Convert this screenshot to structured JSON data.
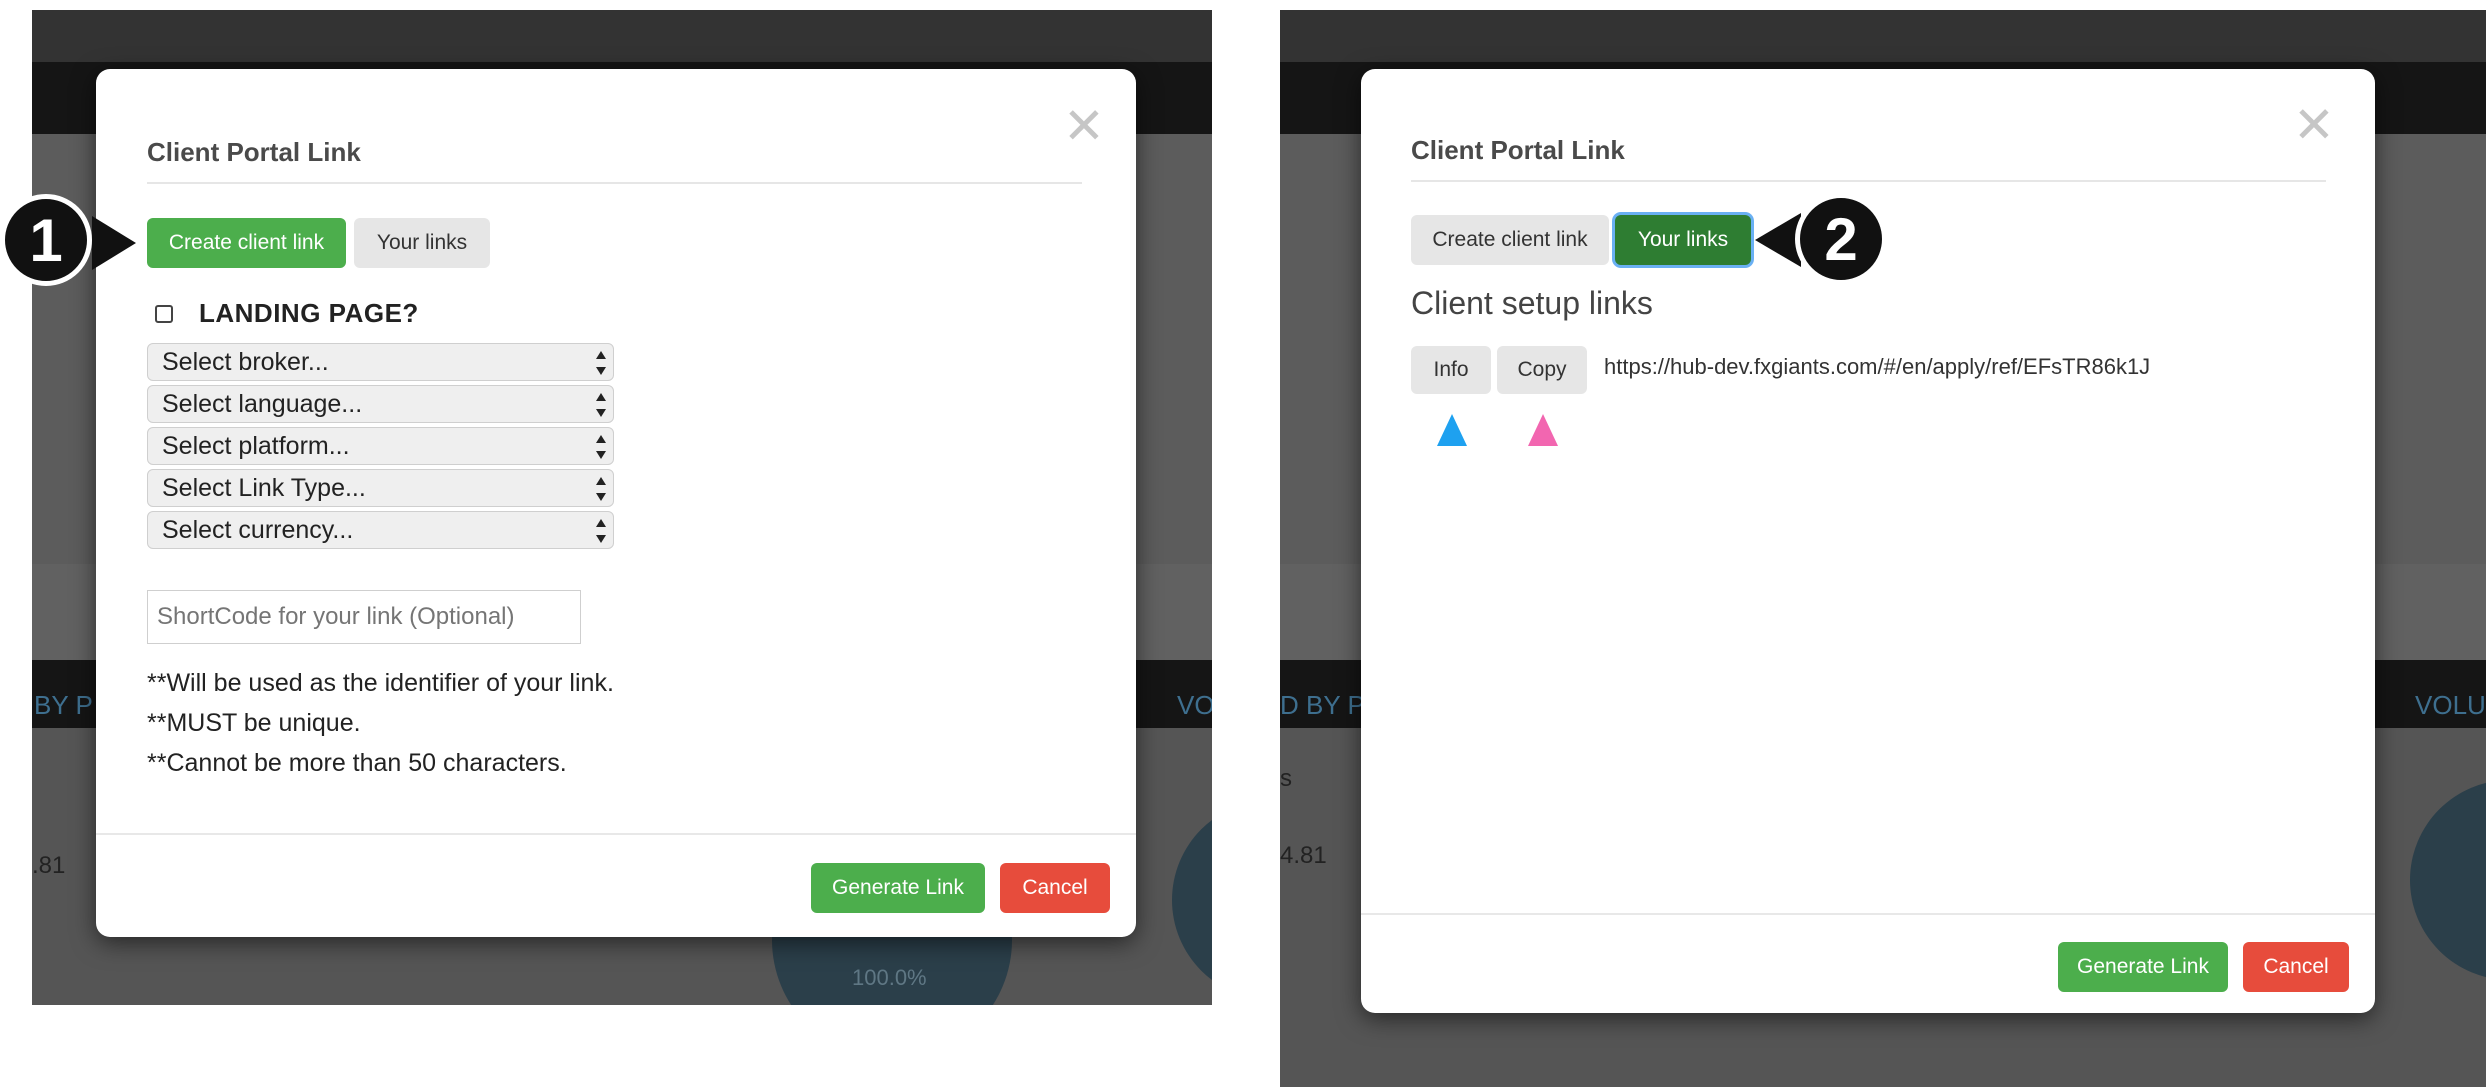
{
  "left_panel": {
    "modal": {
      "title": "Client Portal Link",
      "close_icon": "✕",
      "tabs": {
        "create": "Create client link",
        "your_links": "Your links",
        "active": "create"
      },
      "landing_page_label": "LANDING PAGE?",
      "landing_page_checked": false,
      "selects": [
        "Select broker...",
        "Select language...",
        "Select platform...",
        "Select Link Type...",
        "Select currency..."
      ],
      "shortcode_placeholder": "ShortCode for your link (Optional)",
      "notes": [
        "**Will be used as the identifier of your link.",
        "**MUST be unique.",
        "**Cannot be more than 50 characters."
      ],
      "footer": {
        "generate": "Generate Link",
        "cancel": "Cancel"
      }
    },
    "callout_number": "1",
    "background": {
      "frag_left": "BY P",
      "frag_right": "VO",
      "value": ".81",
      "percent": "100.0%"
    }
  },
  "right_panel": {
    "modal": {
      "title": "Client Portal Link",
      "close_icon": "✕",
      "tabs": {
        "create": "Create client link",
        "your_links": "Your links",
        "active": "your_links"
      },
      "section_title": "Client setup links",
      "link_row": {
        "info_button": "Info",
        "copy_button": "Copy",
        "url": "https://hub-dev.fxgiants.com/#/en/apply/ref/EFsTR86k1J"
      },
      "footer": {
        "generate": "Generate Link",
        "cancel": "Cancel"
      }
    },
    "callout_number": "2",
    "markers": {
      "info_marker_color": "#1ea1f0",
      "copy_marker_color": "#f266b0"
    },
    "background": {
      "frag_left": "D BY P",
      "frag_right": "VOLUM",
      "frag_s": "s",
      "value": "4.81"
    }
  }
}
